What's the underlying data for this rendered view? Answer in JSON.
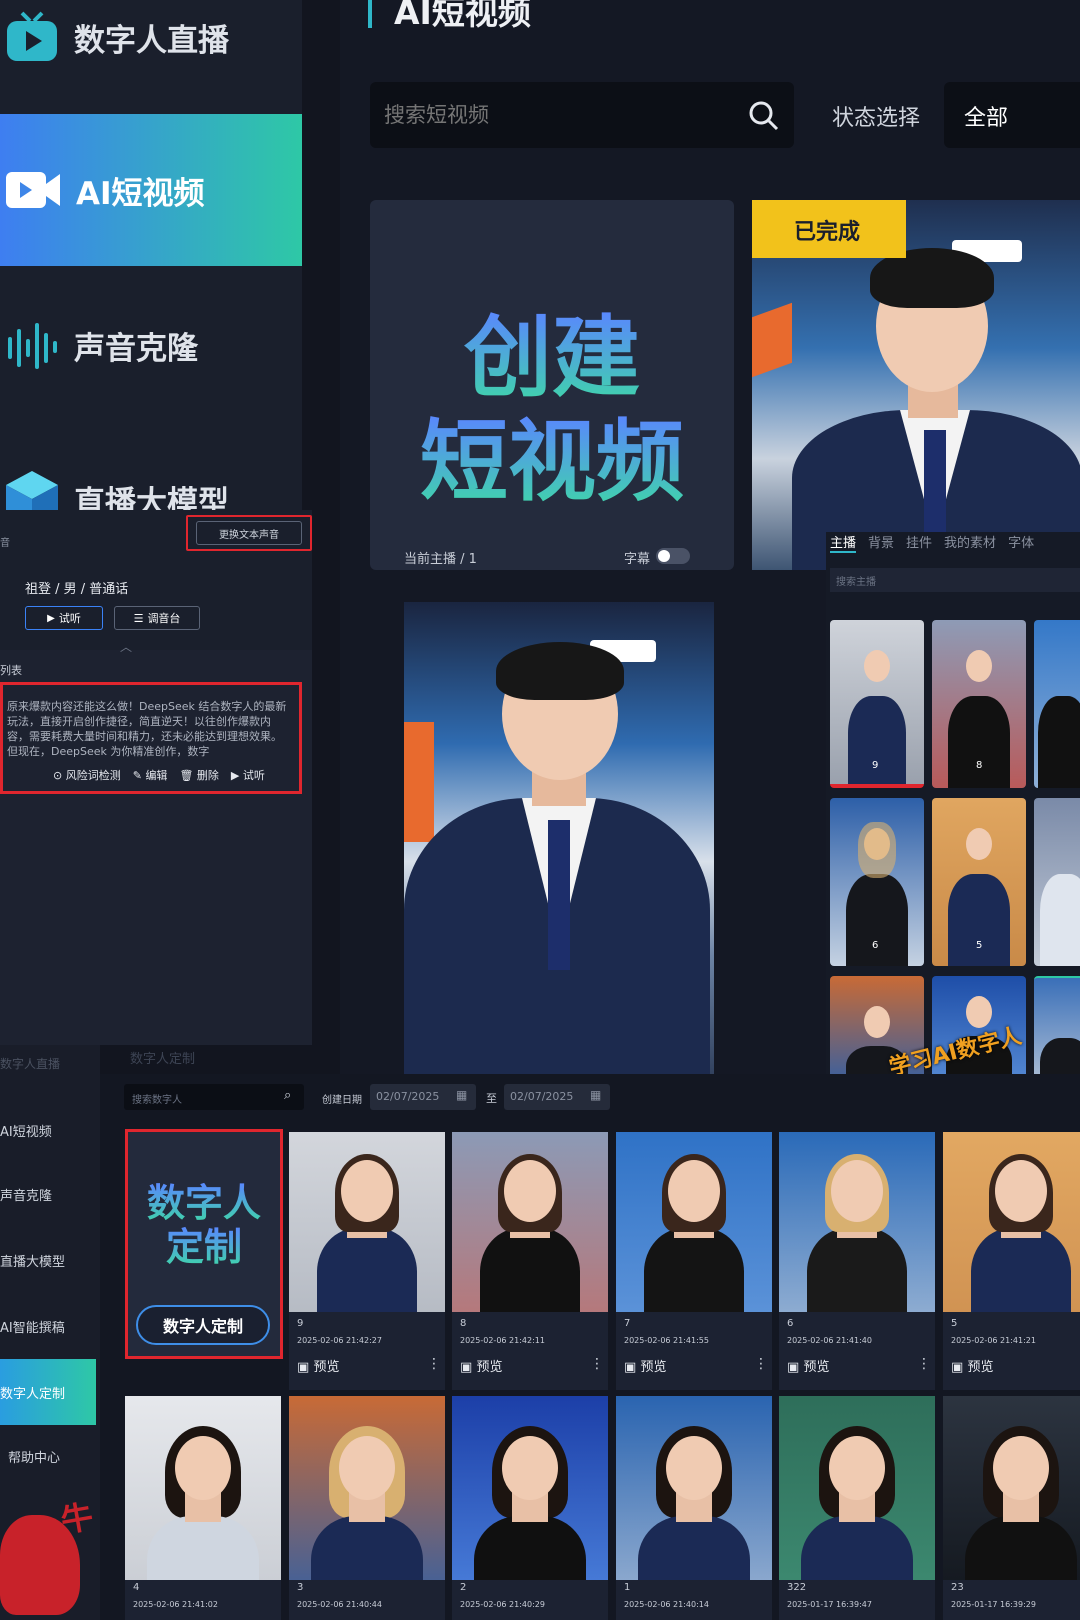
{
  "nav_main": {
    "items": [
      {
        "label": "数字人直播",
        "icon": "tv-icon"
      },
      {
        "label": "AI短视频",
        "icon": "video-camera-icon"
      },
      {
        "label": "声音克隆",
        "icon": "sound-wave-icon"
      },
      {
        "label": "直播大模型",
        "icon": "cube-icon"
      }
    ]
  },
  "page": {
    "title": "AI短视频"
  },
  "search": {
    "placeholder": "搜索短视频"
  },
  "status": {
    "label": "状态选择",
    "value": "全部"
  },
  "create_card": {
    "line1": "创建",
    "line2": "短视频",
    "host_label": "当前主播 / 1",
    "subtitle_label": "字幕"
  },
  "video_card": {
    "badge": "已完成"
  },
  "voice": {
    "change_btn": "更换文本声音",
    "voice_info": "祖登 / 男 / 普通话",
    "listen_btn": "试听",
    "mixer_btn": "调音台",
    "edge_label": "音"
  },
  "script_panel": {
    "label": "列表",
    "text": "原来爆款内容还能这么做！DeepSeek 结合数字人的最新玩法，直接开启创作捷径，简直逆天！以往创作爆款内容，需要耗费大量时间和精力，还未必能达到理想效果。但现在，DeepSeek 为你精准创作，数字",
    "actions": {
      "risk": "风险词检测",
      "edit": "编辑",
      "delete": "删除",
      "listen": "试听"
    }
  },
  "editor": {
    "tabs": [
      "主播",
      "背景",
      "挂件",
      "我的素材",
      "字体"
    ],
    "search_placeholder": "搜索主播",
    "host_numbers": [
      "9",
      "8",
      "6",
      "5"
    ],
    "watermark": "学习AI数字人"
  },
  "nav_small": {
    "items": [
      "数字人直播",
      "AI短视频",
      "声音克隆",
      "直播大模型",
      "AI智能撰稿",
      "数字人定制",
      "帮助中心"
    ],
    "faded_title": "数字人定制"
  },
  "filters": {
    "search_placeholder": "搜索数字人",
    "date_label": "创建日期",
    "date_from": "02/07/2025",
    "date_sep": "至",
    "date_to": "02/07/2025"
  },
  "custom_card": {
    "line1": "数字人",
    "line2": "定制",
    "button": "数字人定制"
  },
  "avatars_row1": [
    {
      "num": "9",
      "date": "2025-02-06 21:42:27",
      "preview": "预览"
    },
    {
      "num": "8",
      "date": "2025-02-06 21:42:11",
      "preview": "预览"
    },
    {
      "num": "7",
      "date": "2025-02-06 21:41:55",
      "preview": "预览"
    },
    {
      "num": "6",
      "date": "2025-02-06 21:41:40",
      "preview": "预览"
    },
    {
      "num": "5",
      "date": "2025-02-06 21:41:21",
      "preview": "预览"
    }
  ],
  "avatars_row2": [
    {
      "num": "4",
      "date": "2025-02-06 21:41:02"
    },
    {
      "num": "3",
      "date": "2025-02-06 21:40:44"
    },
    {
      "num": "2",
      "date": "2025-02-06 21:40:29"
    },
    {
      "num": "1",
      "date": "2025-02-06 21:40:14"
    },
    {
      "num": "322",
      "date": "2025-01-17 16:39:47"
    },
    {
      "num": "23",
      "date": "2025-01-17 16:39:29"
    }
  ],
  "colors": {
    "accent_blue": "#3e7ef1",
    "accent_green": "#2ec8a6",
    "badge_yellow": "#f2c21b",
    "highlight_red": "#e0262e"
  }
}
